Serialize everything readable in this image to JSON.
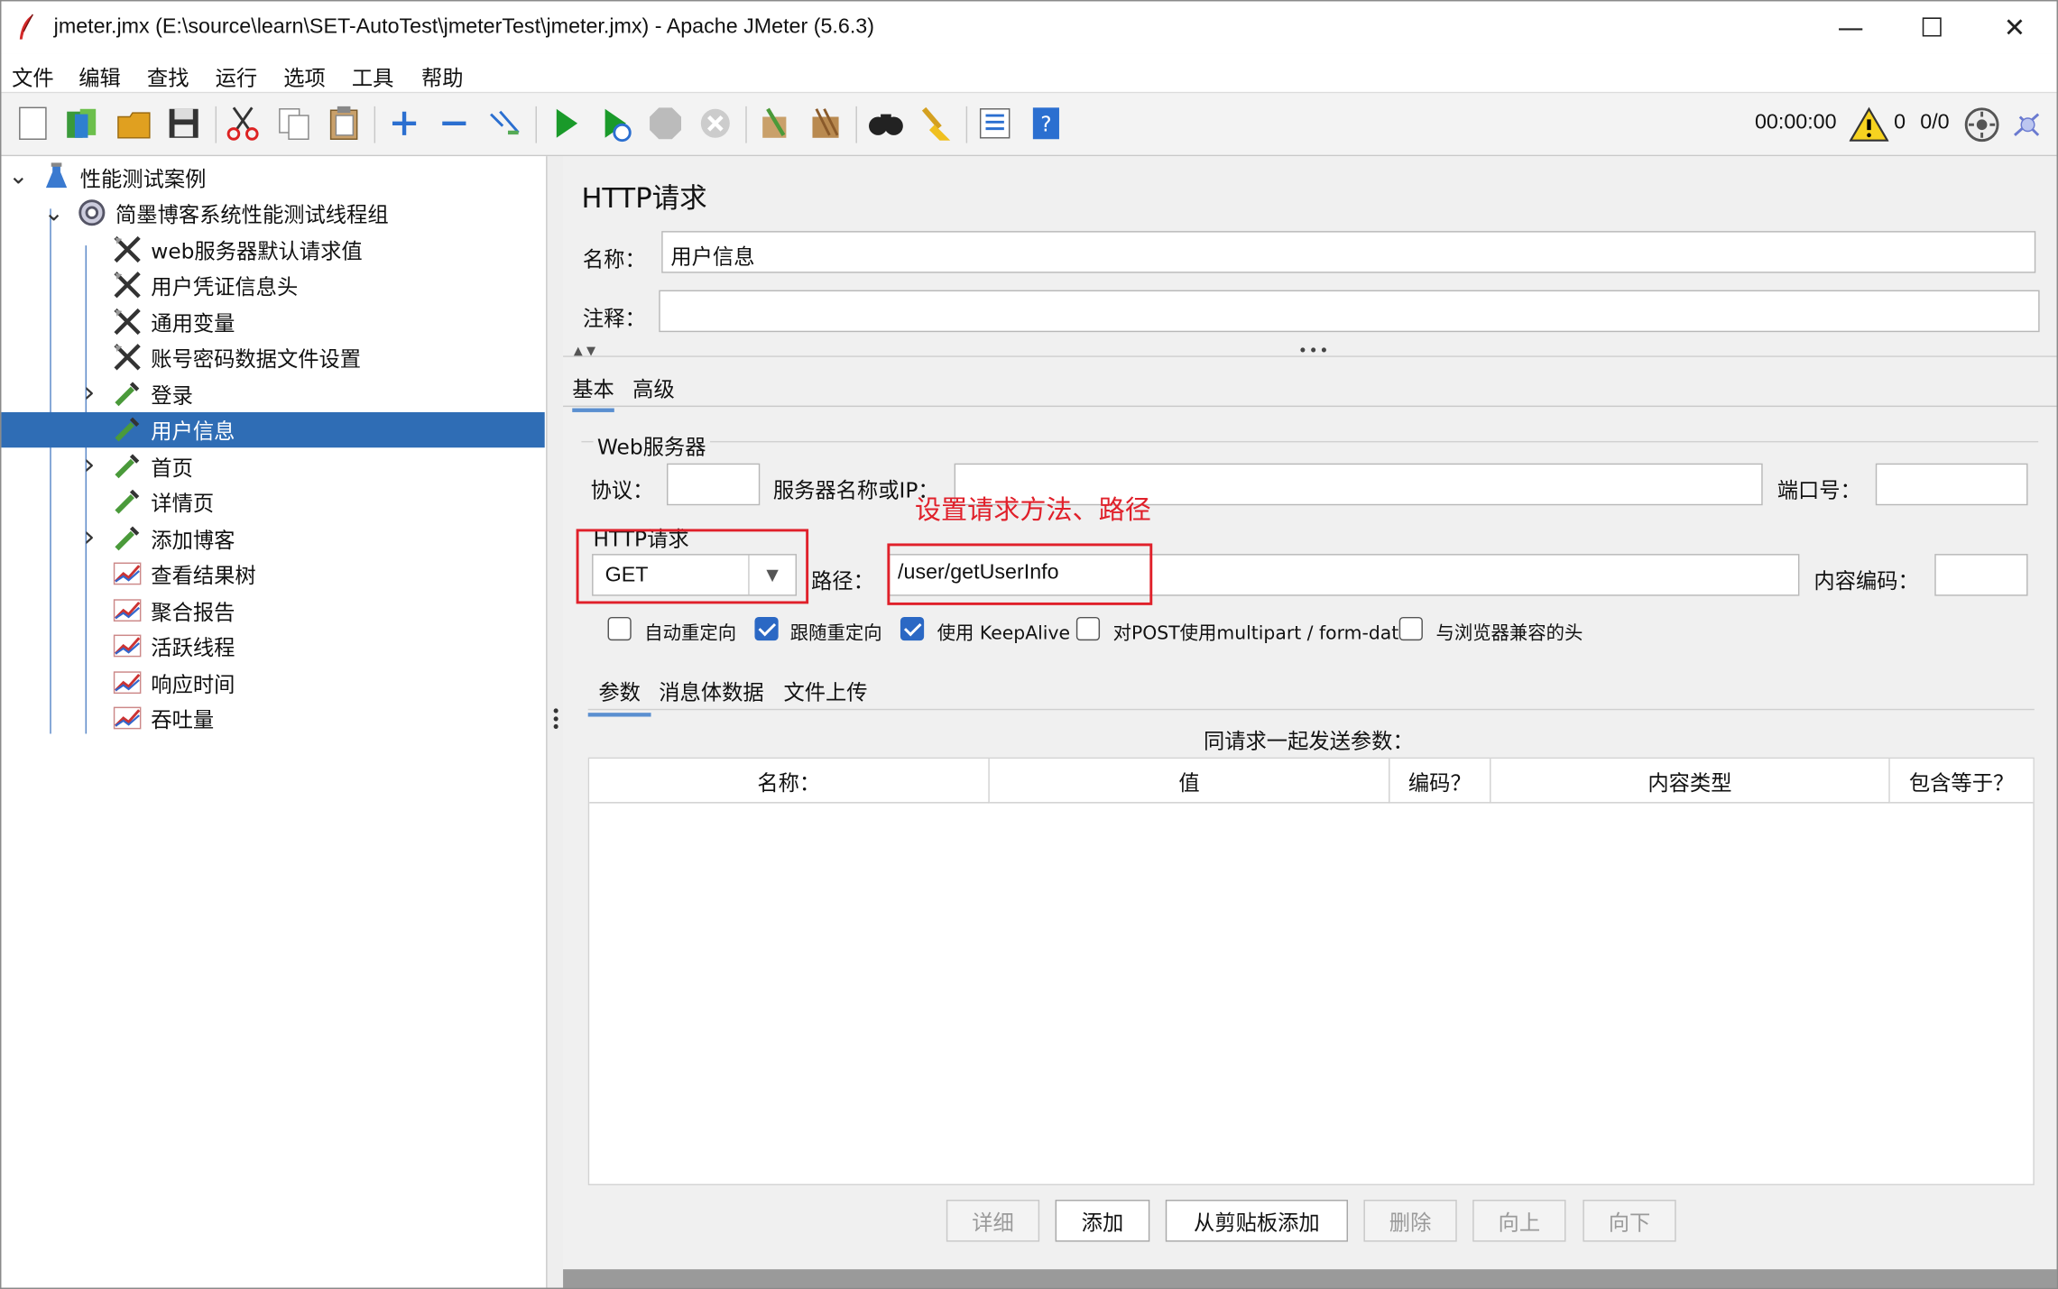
{
  "window": {
    "title": "jmeter.jmx (E:\\source\\learn\\SET-AutoTest\\jmeterTest\\jmeter.jmx) - Apache JMeter (5.6.3)",
    "minimize": "—",
    "maximize": "☐",
    "close": "✕"
  },
  "menu": [
    "文件",
    "编辑",
    "查找",
    "运行",
    "选项",
    "工具",
    "帮助"
  ],
  "toolbar": {
    "buttons": [
      "new-icon",
      "templates-icon",
      "open-icon",
      "save-icon",
      "cut-icon",
      "copy-icon",
      "paste-icon",
      "expand-icon",
      "collapse-icon",
      "toggle-icon",
      "start-icon",
      "start-no-timers-icon",
      "stop-icon",
      "shutdown-icon",
      "clear-icon",
      "clear-all-icon",
      "search-icon",
      "reset-search-icon",
      "function-helper-icon",
      "help-icon"
    ],
    "timer": "00:00:00",
    "warnings": "0",
    "threads": "0/0"
  },
  "tree": [
    {
      "label": "性能测试案例",
      "level": 0,
      "expand": "v",
      "icon": "testplan-icon",
      "selected": false
    },
    {
      "label": "简墨博客系统性能测试线程组",
      "level": 1,
      "expand": "v",
      "icon": "threadgroup-icon",
      "selected": false
    },
    {
      "label": "web服务器默认请求值",
      "level": 2,
      "expand": "",
      "icon": "config-icon",
      "selected": false
    },
    {
      "label": "用户凭证信息头",
      "level": 2,
      "expand": "",
      "icon": "config-icon",
      "selected": false
    },
    {
      "label": "通用变量",
      "level": 2,
      "expand": "",
      "icon": "config-icon",
      "selected": false
    },
    {
      "label": "账号密码数据文件设置",
      "level": 2,
      "expand": "",
      "icon": "config-icon",
      "selected": false
    },
    {
      "label": "登录",
      "level": 2,
      "expand": ">",
      "icon": "sampler-icon",
      "selected": false
    },
    {
      "label": "用户信息",
      "level": 2,
      "expand": "",
      "icon": "sampler-icon",
      "selected": true
    },
    {
      "label": "首页",
      "level": 2,
      "expand": ">",
      "icon": "sampler-icon",
      "selected": false
    },
    {
      "label": "详情页",
      "level": 2,
      "expand": "",
      "icon": "sampler-icon",
      "selected": false
    },
    {
      "label": "添加博客",
      "level": 2,
      "expand": ">",
      "icon": "sampler-icon",
      "selected": false
    },
    {
      "label": "查看结果树",
      "level": 2,
      "expand": "",
      "icon": "listener-icon",
      "selected": false
    },
    {
      "label": "聚合报告",
      "level": 2,
      "expand": "",
      "icon": "listener-icon",
      "selected": false
    },
    {
      "label": "活跃线程",
      "level": 2,
      "expand": "",
      "icon": "listener-icon",
      "selected": false
    },
    {
      "label": "响应时间",
      "level": 2,
      "expand": "",
      "icon": "listener-icon",
      "selected": false
    },
    {
      "label": "吞吐量",
      "level": 2,
      "expand": "",
      "icon": "listener-icon",
      "selected": false
    }
  ],
  "panel": {
    "title": "HTTP请求",
    "name_label": "名称：",
    "name_value": "用户信息",
    "comment_label": "注释：",
    "comment_value": "",
    "tabs": [
      "基本",
      "高级"
    ],
    "web_server_section": "Web服务器",
    "protocol_label": "协议：",
    "protocol_value": "",
    "server_label": "服务器名称或IP：",
    "server_value": "",
    "port_label": "端口号：",
    "port_value": "",
    "http_section": "HTTP请求",
    "method_value": "GET",
    "path_label": "路径：",
    "path_value": "/user/getUserInfo",
    "encoding_label": "内容编码：",
    "encoding_value": "",
    "checkboxes": [
      {
        "label": "自动重定向",
        "checked": false
      },
      {
        "label": "跟随重定向",
        "checked": true
      },
      {
        "label": "使用 KeepAlive",
        "checked": true
      },
      {
        "label": "对POST使用multipart / form-data",
        "checked": false
      },
      {
        "label": "与浏览器兼容的头",
        "checked": false
      }
    ],
    "sub_tabs": [
      "参数",
      "消息体数据",
      "文件上传"
    ],
    "params_caption": "同请求一起发送参数：",
    "columns": [
      "名称：",
      "值",
      "编码？",
      "内容类型",
      "包含等于？"
    ],
    "buttons": [
      {
        "label": "详细",
        "enabled": false
      },
      {
        "label": "添加",
        "enabled": true
      },
      {
        "label": "从剪贴板添加",
        "enabled": true
      },
      {
        "label": "删除",
        "enabled": false
      },
      {
        "label": "向上",
        "enabled": false
      },
      {
        "label": "向下",
        "enabled": false
      }
    ]
  },
  "annotation": {
    "text": "设置请求方法、路径",
    "color": "#e0202a"
  },
  "colors": {
    "selection": "#2f6db5",
    "checkbox_on": "#2b68c4"
  }
}
